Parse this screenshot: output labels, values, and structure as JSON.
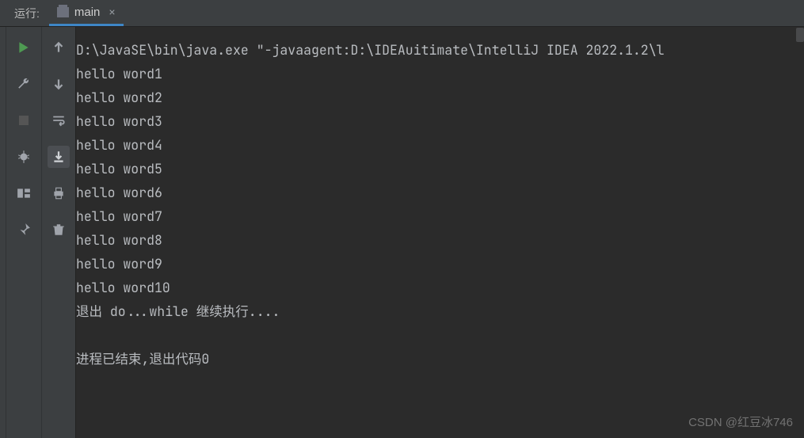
{
  "tabbar": {
    "run_label": "运行:",
    "tab_name": "main",
    "close_glyph": "×"
  },
  "tools_left": {
    "play": "play-icon",
    "wrench": "wrench-icon",
    "stop": "stop-icon",
    "bug": "debug-icon",
    "layout": "layout-icon",
    "pin": "pin-icon"
  },
  "tools_right": {
    "up": "arrow-up-icon",
    "down": "arrow-down-icon",
    "wrap": "soft-wrap-icon",
    "scroll": "scroll-to-end-icon",
    "print": "print-icon",
    "trash": "trash-icon"
  },
  "console_lines": [
    "D:\\JavaSE\\bin\\java.exe \"-javaagent:D:\\IDEAuitimate\\IntelliJ IDEA 2022.1.2\\l",
    "hello word1",
    "hello word2",
    "hello word3",
    "hello word4",
    "hello word5",
    "hello word6",
    "hello word7",
    "hello word8",
    "hello word9",
    "hello word10",
    "退出 do...while 继续执行....",
    "",
    "进程已结束,退出代码0"
  ],
  "watermark": "CSDN @红豆冰746"
}
